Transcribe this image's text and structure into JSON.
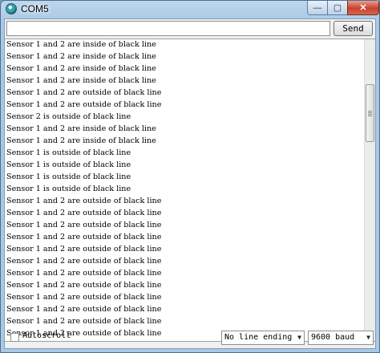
{
  "window": {
    "title": "COM5",
    "controls": {
      "minimize": "—",
      "maximize": "▢",
      "close": "✕"
    }
  },
  "send": {
    "input_value": "",
    "button_label": "Send"
  },
  "output": {
    "lines": [
      "Sensor 1 and 2 are inside of black line",
      "Sensor 1 and 2 are inside of black line",
      "Sensor 1 and 2 are inside of black line",
      "Sensor 1 and 2 are inside of black line",
      "Sensor 1 and 2 are outside of black line",
      "Sensor 1 and 2 are outside of black line",
      "Sensor 2 is outside of black line",
      "Sensor 1 and 2 are inside of black line",
      "Sensor 1 and 2 are inside of black line",
      "Sensor 1 is outside of black line",
      "Sensor 1 is outside of black line",
      "Sensor 1 is outside of black line",
      "Sensor 1 is outside of black line",
      "Sensor 1 and 2 are outside of black line",
      "Sensor 1 and 2 are outside of black line",
      "Sensor 1 and 2 are outside of black line",
      "Sensor 1 and 2 are outside of black line",
      "Sensor 1 and 2 are outside of black line",
      "Sensor 1 and 2 are outside of black line",
      "Sensor 1 and 2 are outside of black line",
      "Sensor 1 and 2 are outside of black line",
      "Sensor 1 and 2 are outside of black line",
      "Sensor 1 and 2 are outside of black line",
      "Sensor 1 and 2 are outside of black line",
      "Sensor 1 and 2 are outside of black line"
    ]
  },
  "footer": {
    "autoscroll_label": "Autoscroll",
    "autoscroll_checked": false,
    "line_ending": "No line ending",
    "baud": "9600 baud",
    "dropdown_arrow": "▼"
  },
  "colors": {
    "title_bar": "#a9c8e4",
    "close_button": "#c8412c"
  }
}
